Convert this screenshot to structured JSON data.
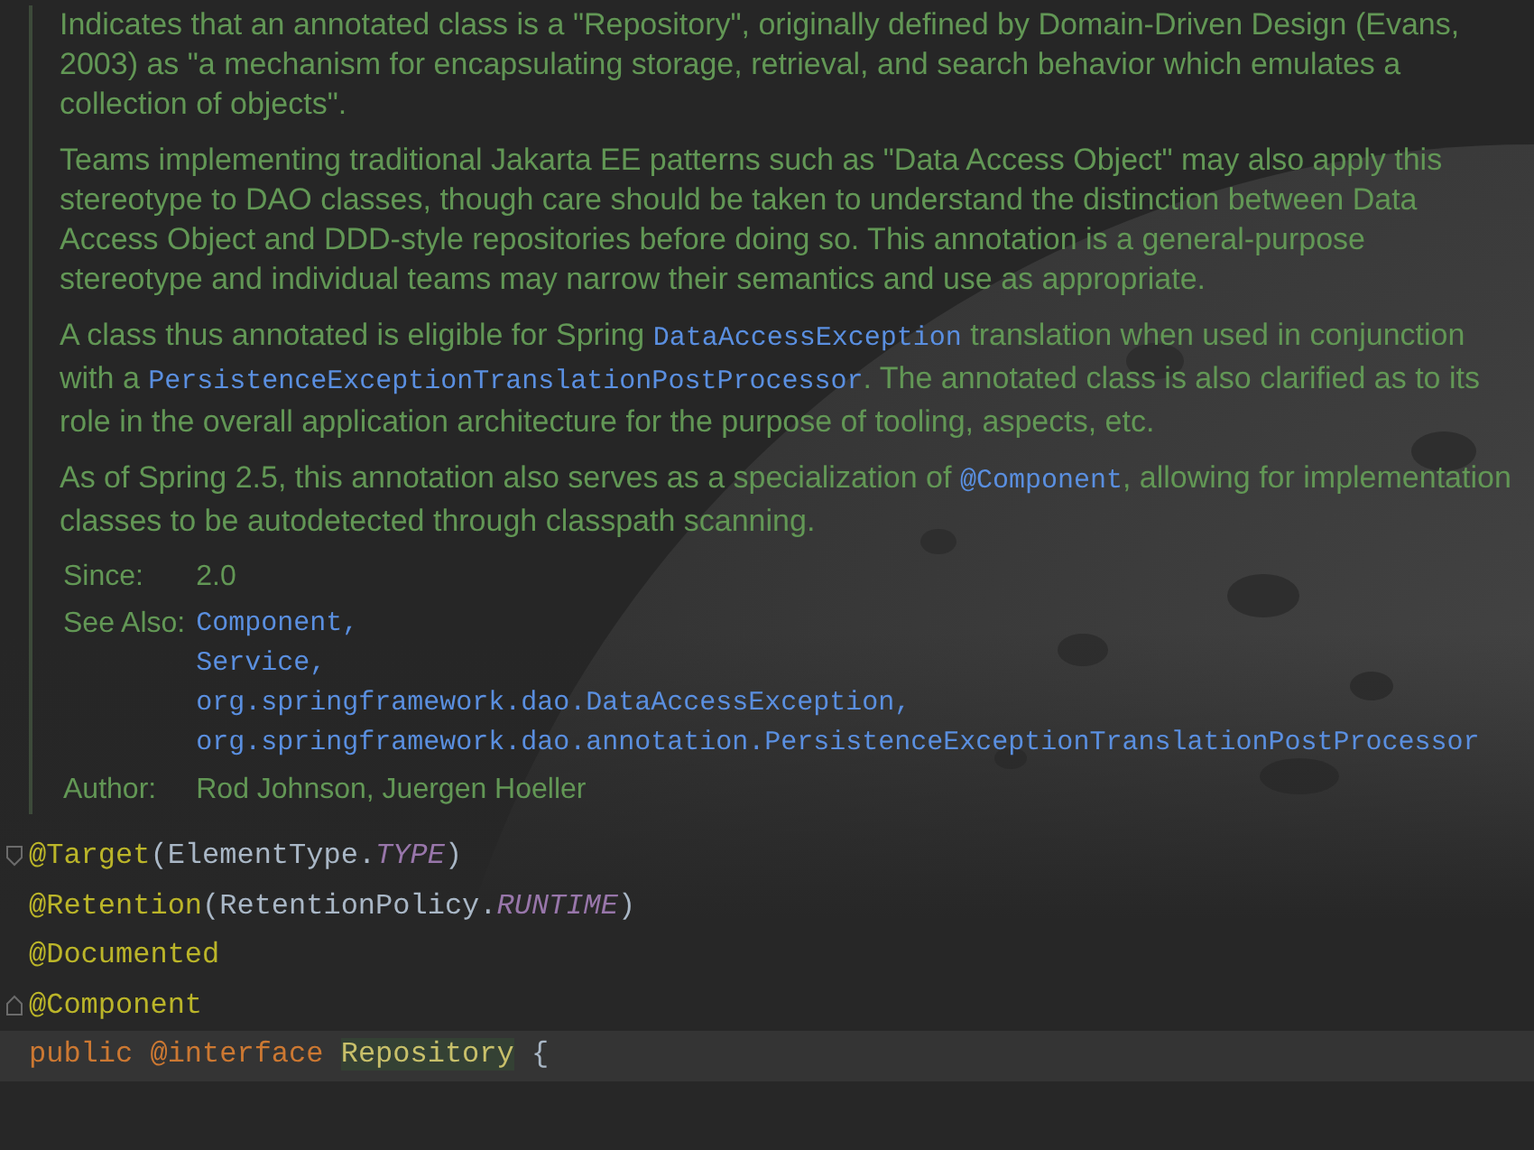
{
  "doc": {
    "paragraphs": [
      [
        {
          "kind": "text",
          "text": "Indicates that an annotated class is a \"Repository\", originally defined by Domain-Driven Design (Evans, 2003) as \"a mechanism for encapsulating storage, retrieval, and search behavior which emulates a collection of objects\"."
        }
      ],
      [
        {
          "kind": "text",
          "text": "Teams implementing traditional Jakarta EE patterns such as \"Data Access Object\" may also apply this stereotype to DAO classes, though care should be taken to understand the distinction between Data Access Object and DDD-style repositories before doing so. This annotation is a general-purpose stereotype and individual teams may narrow their semantics and use as appropriate."
        }
      ],
      [
        {
          "kind": "text",
          "text": "A class thus annotated is eligible for Spring "
        },
        {
          "kind": "code",
          "text": "DataAccessException"
        },
        {
          "kind": "text",
          "text": " translation when used in conjunction with a "
        },
        {
          "kind": "code",
          "text": "PersistenceExceptionTranslationPostProcessor"
        },
        {
          "kind": "text",
          "text": ". The annotated class is also clarified as to its role in the overall application architecture for the purpose of tooling, aspects, etc."
        }
      ],
      [
        {
          "kind": "text",
          "text": "As of Spring 2.5, this annotation also serves as a specialization of "
        },
        {
          "kind": "code",
          "text": "@Component"
        },
        {
          "kind": "text",
          "text": ", allowing for implementation classes to be autodetected through classpath scanning."
        }
      ]
    ],
    "tags": [
      {
        "label": "Since:",
        "kind": "text",
        "values": [
          "2.0"
        ]
      },
      {
        "label": "See Also:",
        "kind": "links",
        "values": [
          "Component,",
          "Service,",
          "org.springframework.dao.DataAccessException,",
          "org.springframework.dao.annotation.PersistenceExceptionTranslationPostProcessor"
        ]
      },
      {
        "label": "Author:",
        "kind": "text",
        "values": [
          "Rod Johnson, Juergen Hoeller"
        ]
      }
    ]
  },
  "code_lines": [
    {
      "fold_start": true,
      "fold_end": false,
      "highlighted": false,
      "tokens": [
        {
          "kind": "annotation",
          "text": "@Target"
        },
        {
          "kind": "plain",
          "text": "(ElementType."
        },
        {
          "kind": "constant",
          "text": "TYPE"
        },
        {
          "kind": "plain",
          "text": ")"
        }
      ]
    },
    {
      "fold_start": false,
      "fold_end": false,
      "highlighted": false,
      "tokens": [
        {
          "kind": "annotation",
          "text": "@Retention"
        },
        {
          "kind": "plain",
          "text": "(RetentionPolicy."
        },
        {
          "kind": "constant",
          "text": "RUNTIME"
        },
        {
          "kind": "plain",
          "text": ")"
        }
      ]
    },
    {
      "fold_start": false,
      "fold_end": false,
      "highlighted": false,
      "tokens": [
        {
          "kind": "annotation",
          "text": "@Documented"
        }
      ]
    },
    {
      "fold_start": false,
      "fold_end": true,
      "highlighted": false,
      "tokens": [
        {
          "kind": "annotation",
          "text": "@Component"
        }
      ]
    },
    {
      "fold_start": false,
      "fold_end": false,
      "highlighted": true,
      "tokens": [
        {
          "kind": "keyword",
          "text": "public"
        },
        {
          "kind": "keyword",
          "text": "@interface"
        },
        {
          "kind": "declaration",
          "text": "Repository"
        },
        {
          "kind": "plain",
          "text": "{"
        }
      ]
    }
  ]
}
